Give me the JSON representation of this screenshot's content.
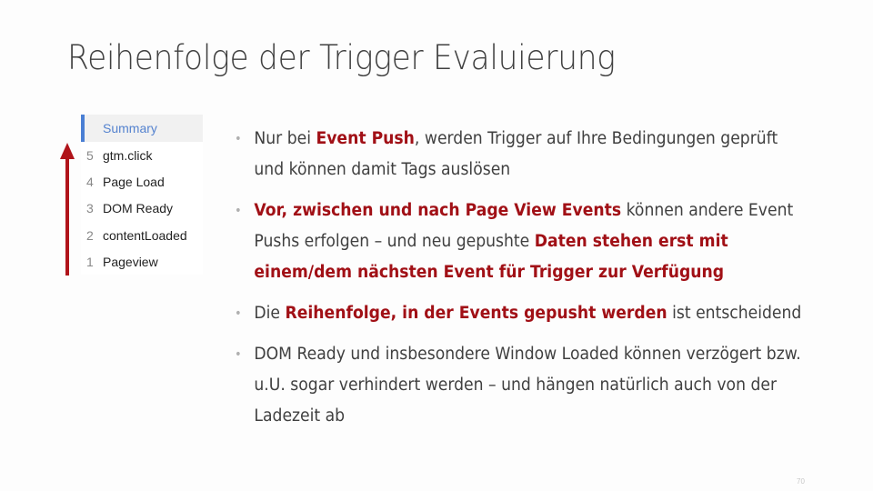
{
  "slide": {
    "title": "Reihenfolge der Trigger Evaluierung",
    "page_number": "70",
    "accent_color": "#a11016"
  },
  "event_panel": {
    "header": "Summary",
    "items": [
      {
        "num": "5",
        "label": "gtm.click"
      },
      {
        "num": "4",
        "label": "Page Load"
      },
      {
        "num": "3",
        "label": "DOM Ready"
      },
      {
        "num": "2",
        "label": "contentLoaded"
      },
      {
        "num": "1",
        "label": "Pageview"
      }
    ],
    "arrow_icon": "up-arrow-icon"
  },
  "bullets": [
    {
      "segments": [
        {
          "text": "Nur bei ",
          "highlight": false
        },
        {
          "text": "Event Push",
          "highlight": true
        },
        {
          "text": ", werden Trigger auf Ihre Bedingungen geprüft und können damit Tags auslösen",
          "highlight": false
        }
      ]
    },
    {
      "segments": [
        {
          "text": "Vor, zwischen und nach Page View Events",
          "highlight": true
        },
        {
          "text": " können andere Event Pushs erfolgen – und neu gepushte ",
          "highlight": false
        },
        {
          "text": "Daten stehen erst mit einem/dem nächsten Event für Trigger zur Verfügung",
          "highlight": true
        }
      ]
    },
    {
      "segments": [
        {
          "text": "Die ",
          "highlight": false
        },
        {
          "text": "Reihenfolge, in der Events gepusht werden",
          "highlight": true
        },
        {
          "text": " ist entscheidend",
          "highlight": false
        }
      ]
    },
    {
      "segments": [
        {
          "text": "DOM Ready und insbesondere Window Loaded können verzögert bzw. u.U. sogar verhindert werden – und hängen natürlich auch von der Ladezeit ab",
          "highlight": false
        }
      ]
    }
  ]
}
